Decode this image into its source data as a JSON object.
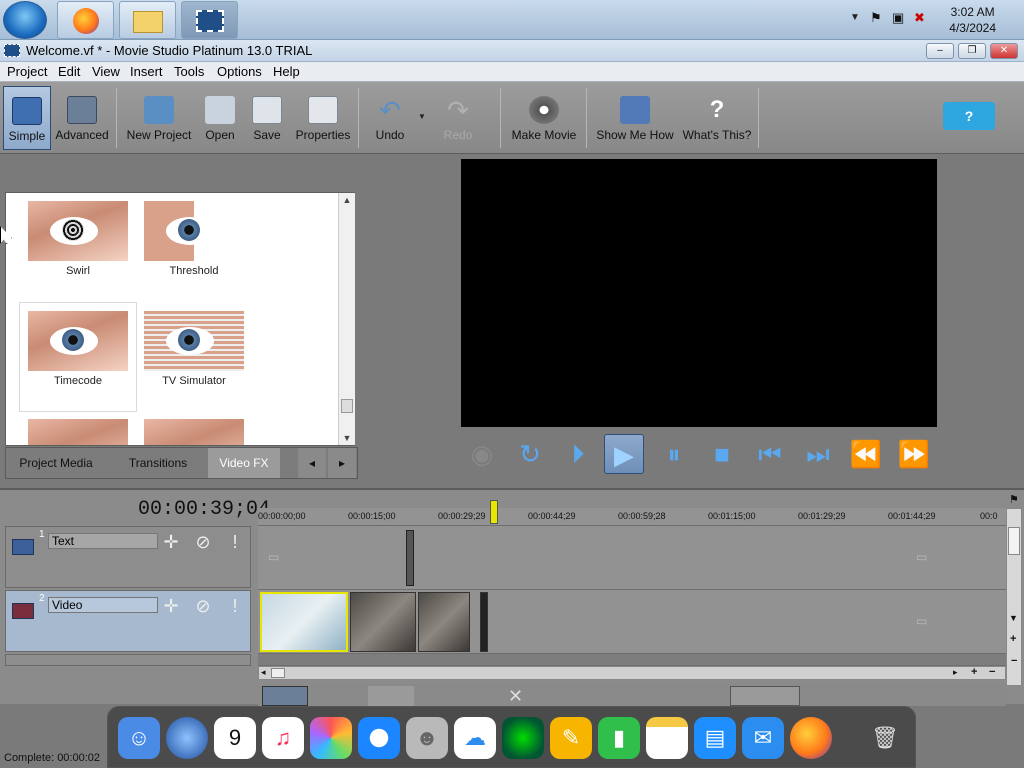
{
  "clock": {
    "time": "3:02 AM",
    "date": "4/3/2024"
  },
  "window": {
    "title": "Welcome.vf * - Movie Studio Platinum 13.0 TRIAL",
    "minimize": "‒",
    "maximize": "❐",
    "close": "✕"
  },
  "menu": [
    "Project",
    "Edit",
    "View",
    "Insert",
    "Tools",
    "Options",
    "Help"
  ],
  "toolbar": {
    "simple": "Simple",
    "advanced": "Advanced",
    "new_project": "New Project",
    "open": "Open",
    "save": "Save",
    "properties": "Properties",
    "undo": "Undo",
    "redo": "Redo",
    "make_movie": "Make Movie",
    "show_me_how": "Show Me How",
    "whats_this": "What's This?",
    "help_bubble": "?"
  },
  "fx": [
    {
      "label": "Swirl"
    },
    {
      "label": "Threshold"
    },
    {
      "label": "Timecode"
    },
    {
      "label": "TV Simulator"
    }
  ],
  "panel_tabs": [
    "Project Media",
    "Transitions",
    "Video FX"
  ],
  "timeline": {
    "timecode": "00:00:39;04",
    "ticks": [
      "00:00:00;00",
      "00:00:15;00",
      "00:00:29;29",
      "00:00:44;29",
      "00:00:59;28",
      "00:01:15;00",
      "00:01:29;29",
      "00:01:44;29",
      "00:0"
    ],
    "tracks": [
      {
        "num": "1",
        "name": "Text"
      },
      {
        "num": "2",
        "name": "Video"
      }
    ]
  },
  "colors": {
    "accent": "#5aa9f0",
    "selection": "#e6e600"
  },
  "status": "Complete: 00:00:02"
}
